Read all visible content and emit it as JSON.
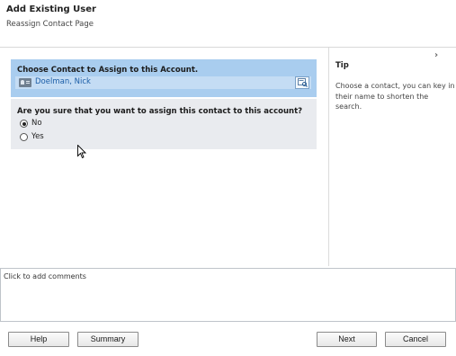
{
  "header": {
    "title": "Add Existing User",
    "subtitle": "Reassign Contact Page"
  },
  "contact_section": {
    "label": "Choose Contact to Assign to this Account.",
    "selected_contact": "Doelman, Nick",
    "contact_icon": "contact-card-icon",
    "lookup_icon": "lookup-icon"
  },
  "confirm_section": {
    "question": "Are you sure that you want to assign this contact to this account?",
    "options": [
      {
        "label": "No",
        "checked": true
      },
      {
        "label": "Yes",
        "checked": false
      }
    ]
  },
  "tip_panel": {
    "title": "Tip",
    "text": "Choose a contact, you can key in their name to shorten the search.",
    "collapse_icon": "chevron-right-icon"
  },
  "comments": {
    "placeholder": "Click to add comments"
  },
  "buttons": {
    "help": "Help",
    "summary": "Summary",
    "next": "Next",
    "cancel": "Cancel"
  },
  "colors": {
    "contact_section_bg": "#a9cdef",
    "contact_field_bg": "#c4dcf4",
    "confirm_section_bg": "#e9ebef",
    "link_color": "#1d5fa8"
  }
}
